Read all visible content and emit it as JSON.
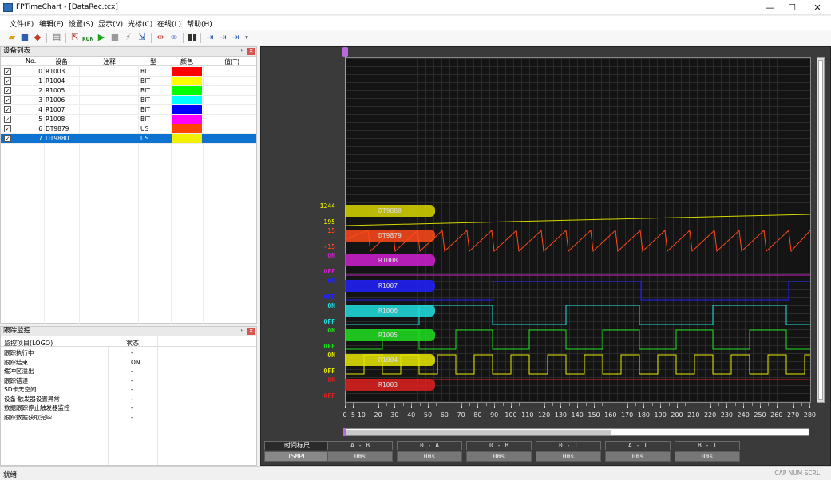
{
  "window": {
    "title": "FPTimeChart - [DataRec.tcx]"
  },
  "menu": [
    "文件(F)",
    "编辑(E)",
    "设置(S)",
    "显示(V)",
    "光标(C)",
    "在线(L)",
    "帮助(H)"
  ],
  "toolbar": {
    "run_label": "RUN"
  },
  "device_panel": {
    "title": "设备列表",
    "columns": {
      "no": "No.",
      "device": "设备",
      "comment": "注释",
      "type": "型",
      "color": "颜色",
      "value": "值(T)"
    },
    "rows": [
      {
        "no": "0",
        "device": "R1003",
        "type": "BIT",
        "color": "#ff0000"
      },
      {
        "no": "1",
        "device": "R1004",
        "type": "BIT",
        "color": "#ffff00"
      },
      {
        "no": "2",
        "device": "R1005",
        "type": "BIT",
        "color": "#00ff00"
      },
      {
        "no": "3",
        "device": "R1006",
        "type": "BIT",
        "color": "#00ffff"
      },
      {
        "no": "4",
        "device": "R1007",
        "type": "BIT",
        "color": "#0000ff"
      },
      {
        "no": "5",
        "device": "R1008",
        "type": "BIT",
        "color": "#ff00ff"
      },
      {
        "no": "6",
        "device": "DT9879",
        "type": "US",
        "color": "#ff4500"
      },
      {
        "no": "7",
        "device": "DT9880",
        "type": "US",
        "color": "#f0f000"
      }
    ]
  },
  "monitor_panel": {
    "title": "跟踪监控",
    "columns": {
      "item": "监控项目(LOGO)",
      "status": "状态"
    },
    "rows": [
      {
        "item": "跟踪执行中",
        "status": "-"
      },
      {
        "item": "跟踪结束",
        "status": "ON"
      },
      {
        "item": "缓冲区溢出",
        "status": "-"
      },
      {
        "item": "跟踪错误",
        "status": "-"
      },
      {
        "item": "SD卡无空间",
        "status": "-"
      },
      {
        "item": "设备·触发器设置异常",
        "status": "-"
      },
      {
        "item": "数据跟踪停止触发器监控",
        "status": "-"
      },
      {
        "item": "跟踪数据获取完毕",
        "status": "-"
      }
    ]
  },
  "chart": {
    "signals": [
      {
        "name": "DT9880",
        "high_label": "1244",
        "low_label": "195",
        "color": "#d8d800"
      },
      {
        "name": "DT9879",
        "high_label": "15",
        "low_label": "-15",
        "color": "#ff4a1a"
      },
      {
        "name": "R1008",
        "high_label": "ON",
        "low_label": "OFF",
        "color": "#d020d0"
      },
      {
        "name": "R1007",
        "high_label": "ON",
        "low_label": "OFF",
        "color": "#2020ff"
      },
      {
        "name": "R1006",
        "high_label": "ON",
        "low_label": "OFF",
        "color": "#20e0e0"
      },
      {
        "name": "R1005",
        "high_label": "ON",
        "low_label": "OFF",
        "color": "#20e020"
      },
      {
        "name": "R1004",
        "high_label": "ON",
        "low_label": "OFF",
        "color": "#e8e800"
      },
      {
        "name": "R1003",
        "high_label": "ON",
        "low_label": "OFF",
        "color": "#e02020"
      }
    ],
    "ticks": [
      "0",
      "5",
      "10",
      "20",
      "30",
      "40",
      "50",
      "60",
      "70",
      "80",
      "90",
      "100",
      "110",
      "120",
      "130",
      "140",
      "150",
      "160",
      "170",
      "180",
      "190",
      "200",
      "210",
      "220",
      "230",
      "240",
      "250",
      "260",
      "270",
      "280"
    ]
  },
  "measurements": {
    "time_scale": {
      "label": "时间标尺",
      "value": "1SMPL"
    },
    "items": [
      {
        "label": "A - B",
        "value": "0ms"
      },
      {
        "label": "0 - A",
        "value": "0ms"
      },
      {
        "label": "0 - B",
        "value": "0ms"
      },
      {
        "label": "0 - T",
        "value": "0ms"
      },
      {
        "label": "A - T",
        "value": "0ms"
      },
      {
        "label": "B - T",
        "value": "0ms"
      }
    ]
  },
  "status": {
    "left": "就绪",
    "right": "CAP  NUM  SCRL"
  }
}
